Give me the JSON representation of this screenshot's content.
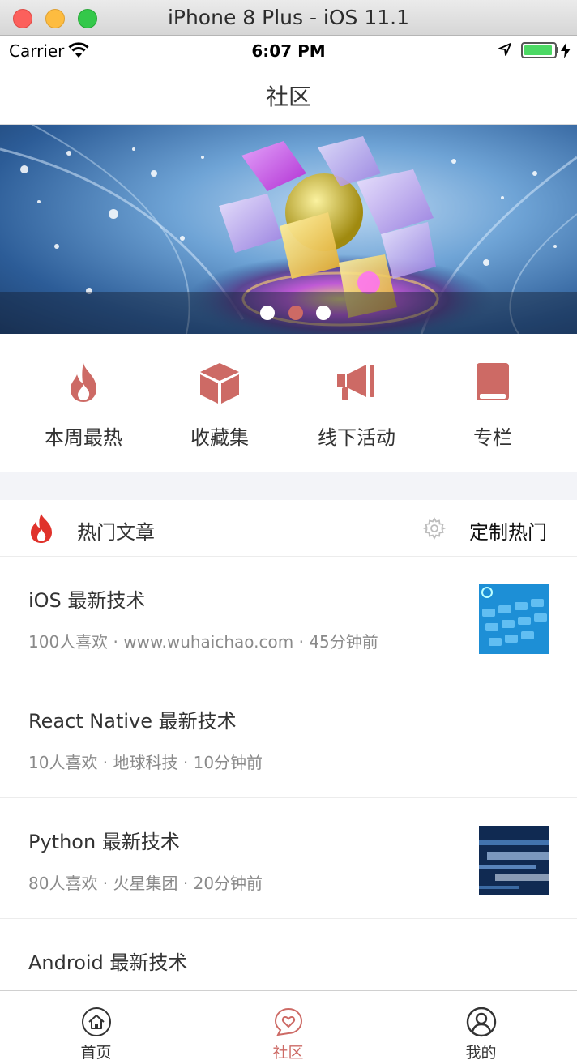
{
  "window": {
    "title": "iPhone 8 Plus - iOS 11.1"
  },
  "status_bar": {
    "carrier": "Carrier",
    "time": "6:07 PM"
  },
  "nav": {
    "title": "社区"
  },
  "banner": {
    "page_count": 3,
    "active_index": 1
  },
  "categories": [
    {
      "label": "本周最热",
      "icon": "flame-icon"
    },
    {
      "label": "收藏集",
      "icon": "box-icon"
    },
    {
      "label": "线下活动",
      "icon": "megaphone-icon"
    },
    {
      "label": "专栏",
      "icon": "book-icon"
    }
  ],
  "hot_section": {
    "title": "热门文章",
    "custom_label": "定制热门"
  },
  "articles": [
    {
      "title": "iOS 最新技术",
      "meta": "100人喜欢 · www.wuhaichao.com · 45分钟前",
      "has_thumb": true
    },
    {
      "title": "React Native 最新技术",
      "meta": "10人喜欢 · 地球科技 · 10分钟前",
      "has_thumb": false
    },
    {
      "title": "Python 最新技术",
      "meta": "80人喜欢 · 火星集团 · 20分钟前",
      "has_thumb": true
    },
    {
      "title": "Android 最新技术",
      "meta": "",
      "has_thumb": false
    }
  ],
  "tabs": [
    {
      "label": "首页",
      "icon": "home-icon",
      "active": false
    },
    {
      "label": "社区",
      "icon": "community-icon",
      "active": true
    },
    {
      "label": "我的",
      "icon": "profile-icon",
      "active": false
    }
  ],
  "colors": {
    "accent": "#cd6a65",
    "flame_red": "#e0322b",
    "separator": "#f3f4f8"
  }
}
